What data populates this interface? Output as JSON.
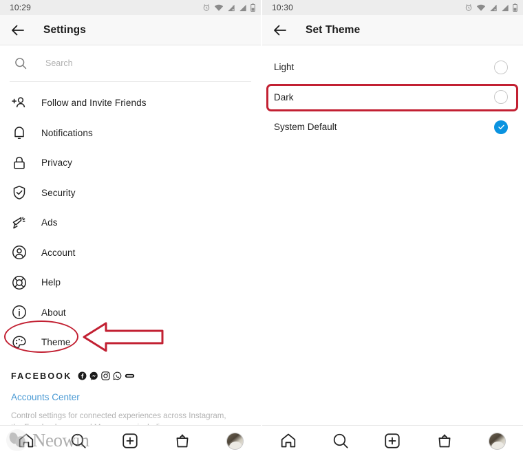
{
  "left_screen": {
    "status_bar": {
      "time": "10:29",
      "icons": [
        "alarm-icon",
        "wifi-icon",
        "signal-1-icon",
        "signal-2-icon",
        "battery-icon"
      ]
    },
    "app_bar": {
      "back": "back-arrow-icon",
      "title": "Settings"
    },
    "search": {
      "icon": "search-icon",
      "placeholder": "Search",
      "value": ""
    },
    "settings_items": [
      {
        "icon": "follow-invite-friends-icon",
        "label": "Follow and Invite Friends"
      },
      {
        "icon": "bell-icon",
        "label": "Notifications"
      },
      {
        "icon": "lock-icon",
        "label": "Privacy"
      },
      {
        "icon": "shield-check-icon",
        "label": "Security"
      },
      {
        "icon": "megaphone-icon",
        "label": "Ads"
      },
      {
        "icon": "account-circle-icon",
        "label": "Account"
      },
      {
        "icon": "lifebuoy-icon",
        "label": "Help"
      },
      {
        "icon": "info-circle-icon",
        "label": "About"
      },
      {
        "icon": "palette-icon",
        "label": "Theme"
      }
    ],
    "facebook_block": {
      "word": "FACEBOOK",
      "icons": [
        "facebook-icon",
        "messenger-icon",
        "instagram-icon",
        "whatsapp-icon",
        "oculus-icon"
      ],
      "accounts_center": "Accounts Center",
      "description": "Control settings for connected experiences across Instagram, the Facebook app, and Messenger, including..."
    },
    "annotations": {
      "ellipse_target": "Theme",
      "arrow": "left-pointing-arrow",
      "color": "#c22032"
    }
  },
  "right_screen": {
    "status_bar": {
      "time": "10:30",
      "icons": [
        "alarm-icon",
        "wifi-icon",
        "signal-1-icon",
        "signal-2-icon",
        "battery-icon"
      ]
    },
    "app_bar": {
      "back": "back-arrow-icon",
      "title": "Set Theme"
    },
    "theme_options": [
      {
        "label": "Light",
        "selected": false
      },
      {
        "label": "Dark",
        "selected": false
      },
      {
        "label": "System Default",
        "selected": true
      }
    ],
    "annotations": {
      "highlight_target": "Dark",
      "color": "#c22032"
    }
  },
  "bottom_nav": {
    "items": [
      {
        "icon": "home-icon",
        "label": "Home"
      },
      {
        "icon": "search-icon",
        "label": "Search"
      },
      {
        "icon": "plus-box-icon",
        "label": "Create"
      },
      {
        "icon": "shop-bag-icon",
        "label": "Shop"
      },
      {
        "icon": "profile-avatar",
        "label": "Profile"
      }
    ]
  },
  "watermark": {
    "text": "Neowin"
  },
  "colors": {
    "accent_blue": "#0a93e0",
    "link_blue": "#4a9ad4",
    "annotation_red": "#c22032",
    "status_bar_bg": "#ededed",
    "app_bar_bg": "#f8f8f8"
  }
}
